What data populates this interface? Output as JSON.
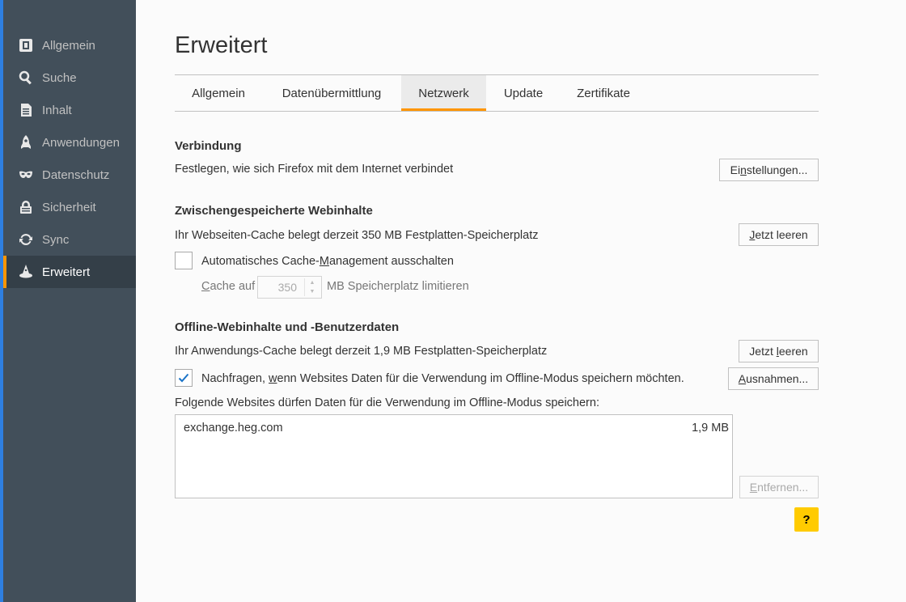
{
  "sidebar": {
    "items": [
      {
        "label": "Allgemein",
        "icon": "general-icon"
      },
      {
        "label": "Suche",
        "icon": "search-icon"
      },
      {
        "label": "Inhalt",
        "icon": "content-icon"
      },
      {
        "label": "Anwendungen",
        "icon": "rocket-icon"
      },
      {
        "label": "Datenschutz",
        "icon": "mask-icon"
      },
      {
        "label": "Sicherheit",
        "icon": "lock-icon"
      },
      {
        "label": "Sync",
        "icon": "sync-icon"
      },
      {
        "label": "Erweitert",
        "icon": "wizard-hat-icon"
      }
    ],
    "active_index": 7
  },
  "page": {
    "title": "Erweitert"
  },
  "tabs": [
    {
      "label": "Allgemein"
    },
    {
      "label": "Datenübermittlung"
    },
    {
      "label": "Netzwerk"
    },
    {
      "label": "Update"
    },
    {
      "label": "Zertifikate"
    }
  ],
  "active_tab": 2,
  "connection": {
    "heading": "Verbindung",
    "description": "Festlegen, wie sich Firefox mit dem Internet verbindet",
    "settings_button_pre": "Ei",
    "settings_button_key": "n",
    "settings_button_post": "stellungen..."
  },
  "cache": {
    "heading": "Zwischengespeicherte Webinhalte",
    "description": "Ihr Webseiten-Cache belegt derzeit 350 MB Festplatten-Speicherplatz",
    "clear_pre": "",
    "clear_key": "J",
    "clear_post": "etzt leeren",
    "override_pre": "Automatisches Cache-",
    "override_key": "M",
    "override_post": "anagement ausschalten",
    "override_checked": false,
    "limit_key": "C",
    "limit_pre": "ache auf",
    "limit_value": "350",
    "limit_post": "MB Speicherplatz limitieren"
  },
  "offline": {
    "heading": "Offline-Webinhalte und -Benutzerdaten",
    "description": "Ihr Anwendungs-Cache belegt derzeit 1,9 MB Festplatten-Speicherplatz",
    "clear_pre": "Jetzt ",
    "clear_key": "l",
    "clear_post": "eeren",
    "notify_pre": "Nachfragen, ",
    "notify_key": "w",
    "notify_post": "enn Websites Daten für die Verwendung im Offline-Modus speichern möchten.",
    "notify_checked": true,
    "exceptions_pre": "",
    "exceptions_key": "A",
    "exceptions_post": "usnahmen...",
    "list_label": "Folgende Websites dürfen Daten für die Verwendung im Offline-Modus speichern:",
    "sites": [
      {
        "site": "exchange.heg.com",
        "size": "1,9 MB"
      }
    ],
    "remove_pre": "",
    "remove_key": "E",
    "remove_post": "ntfernen..."
  },
  "help": {
    "label": "?"
  },
  "colors": {
    "accent": "#ff9500",
    "sidebar": "#424f5a",
    "sidebar_active": "#343f48",
    "check": "#1a73c7",
    "help": "#ffcb00"
  }
}
